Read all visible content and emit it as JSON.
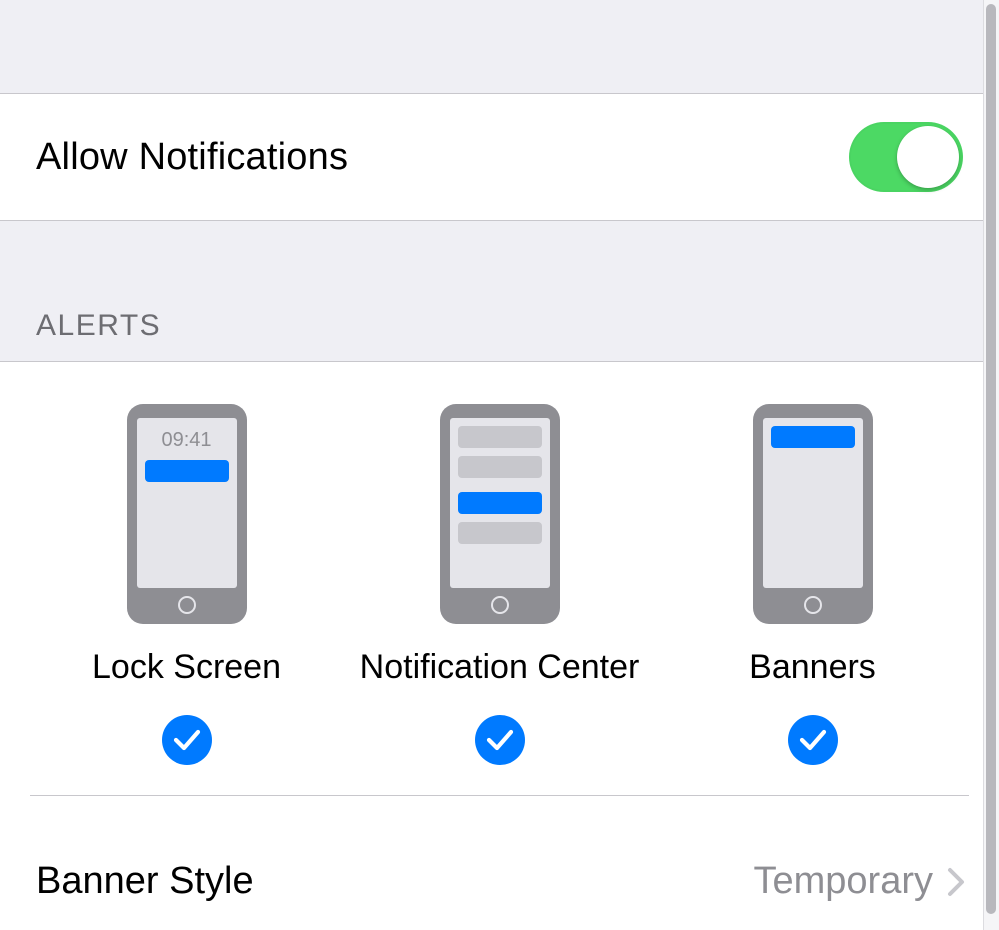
{
  "allow": {
    "label": "Allow Notifications",
    "enabled": true
  },
  "alertsHeader": "ALERTS",
  "lockScreen": {
    "label": "Lock Screen",
    "time": "09:41",
    "checked": true
  },
  "notificationCenter": {
    "label": "Notification Center",
    "checked": true
  },
  "banners": {
    "label": "Banners",
    "checked": true
  },
  "bannerStyle": {
    "label": "Banner Style",
    "value": "Temporary"
  },
  "colors": {
    "accent": "#007aff",
    "toggleOn": "#4cd964",
    "rowBg": "#ffffff",
    "pageBg": "#efeff4",
    "secondaryText": "#8e8e93",
    "separator": "#c8c7cc"
  }
}
